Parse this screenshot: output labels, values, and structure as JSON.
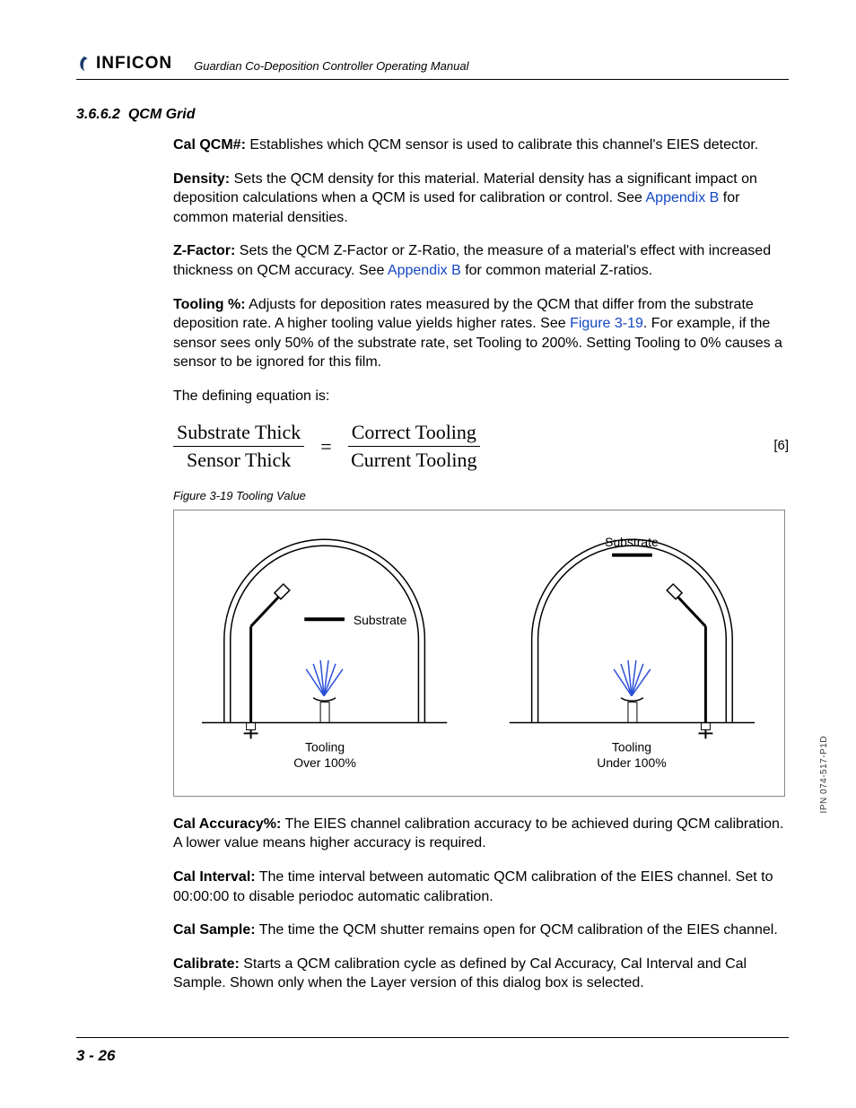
{
  "header": {
    "brand": "INFICON",
    "manual_title": "Guardian Co-Deposition Controller Operating Manual"
  },
  "section": {
    "number": "3.6.6.2",
    "title": "QCM Grid"
  },
  "paragraphs": {
    "cal_qcm_term": "Cal QCM#:",
    "cal_qcm_body": " Establishes which QCM sensor is used to calibrate this channel's EIES detector.",
    "density_term": "Density:",
    "density_body_a": " Sets the QCM density for this material. Material density has a significant impact on deposition calculations when a QCM is used for calibration or control. See ",
    "density_link": "Appendix B",
    "density_body_b": " for common material densities.",
    "zfactor_term": "Z-Factor:",
    "zfactor_body_a": " Sets the QCM Z-Factor or Z-Ratio, the measure of a material's effect with increased thickness on QCM accuracy. See ",
    "zfactor_link": "Appendix B",
    "zfactor_body_b": " for common material Z-ratios.",
    "tooling_term": "Tooling %:",
    "tooling_body_a": " Adjusts for deposition rates measured by the QCM that differ from the substrate deposition rate. A higher tooling value yields higher rates. See ",
    "tooling_link": "Figure 3-19",
    "tooling_body_b": ". For example, if the sensor sees only 50% of the substrate rate, set Tooling to 200%. Setting Tooling to 0% causes a sensor to be ignored for this film.",
    "defining_eq_intro": "The defining equation is:",
    "cal_accuracy_term": "Cal Accuracy%:",
    "cal_accuracy_body": " The EIES channel calibration accuracy to be achieved during QCM calibration. A lower value means higher accuracy is required.",
    "cal_interval_term": "Cal Interval:",
    "cal_interval_body": " The time interval between automatic QCM calibration of the EIES channel. Set to 00:00:00 to disable periodoc automatic calibration.",
    "cal_sample_term": "Cal Sample:",
    "cal_sample_body": " The time the QCM shutter remains open for QCM calibration of the EIES channel.",
    "calibrate_term": "Calibrate:",
    "calibrate_body": " Starts a QCM calibration cycle as defined by Cal Accuracy, Cal Interval and Cal Sample. Shown only when the Layer version of this dialog box is selected."
  },
  "equation": {
    "num1": "Substrate Thick",
    "den1": "Sensor Thick",
    "eq": "=",
    "num2": "Correct Tooling",
    "den2": "Current Tooling",
    "ref": "[6]"
  },
  "figure": {
    "caption": "Figure 3-19  Tooling Value",
    "substrate_label": "Substrate",
    "left_caption_1": "Tooling",
    "left_caption_2": "Over 100%",
    "right_caption_1": "Tooling",
    "right_caption_2": "Under 100%"
  },
  "sidetext": "IPN 074-517-P1D",
  "footer": {
    "page": "3 - 26"
  }
}
